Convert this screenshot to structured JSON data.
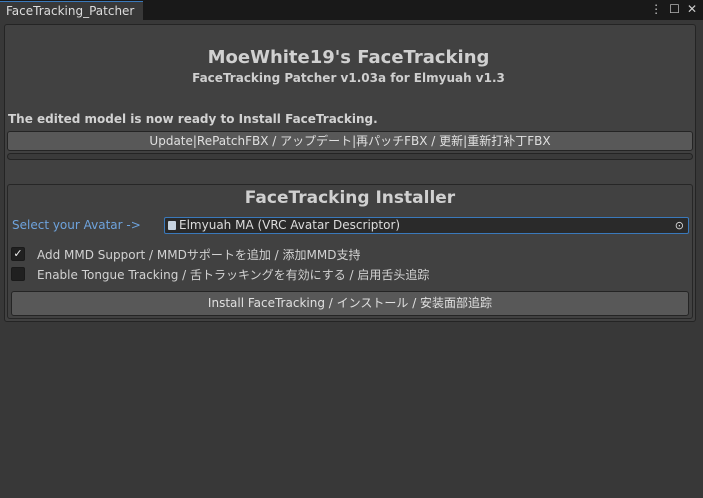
{
  "window": {
    "tab": "FaceTracking_Patcher",
    "menu_icon": "⋮",
    "max_icon": "☐",
    "close_icon": "✕"
  },
  "header": {
    "title": "MoeWhite19's FaceTracking",
    "subtitle": "FaceTracking Patcher v1.03a for Elmyuah v1.3"
  },
  "status": "The edited model is now ready to Install FaceTracking.",
  "update_button": "Update|RePatchFBX / アップデート|再パッチFBX / 更新|重新打补丁FBX",
  "installer": {
    "title": "FaceTracking Installer",
    "avatar_label": "Select your Avatar ->",
    "avatar_value": "Elmyuah MA (VRC Avatar Descriptor)",
    "options": [
      {
        "label": "Add MMD Support / MMDサポートを追加 / 添加MMD支持",
        "checked": true
      },
      {
        "label": "Enable Tongue Tracking / 舌トラッキングを有効にする / 启用舌头追踪",
        "checked": false
      }
    ],
    "install_button": "Install FaceTracking / インストール / 安装面部追踪"
  }
}
